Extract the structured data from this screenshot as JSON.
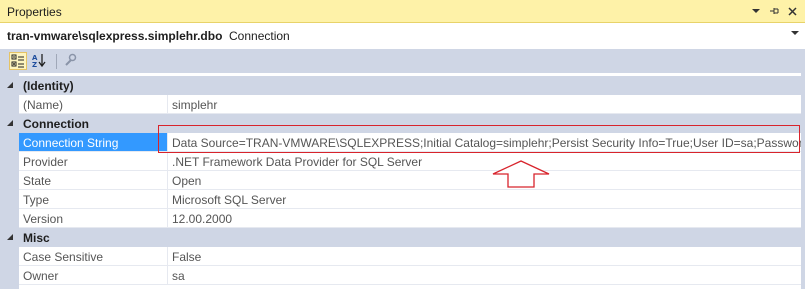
{
  "window": {
    "title": "Properties"
  },
  "object_selector": {
    "name": "tran-vmware\\sqlexpress.simplehr.dbo",
    "type": "Connection"
  },
  "toolbar": {
    "buttons": [
      "categorized-icon",
      "alphabetical-icon",
      "property-pages-icon"
    ]
  },
  "categories": [
    {
      "label": "(Identity)",
      "properties": [
        {
          "name": "(Name)",
          "value": "simplehr"
        }
      ]
    },
    {
      "label": "Connection",
      "properties": [
        {
          "name": "Connection String",
          "value": "Data Source=TRAN-VMWARE\\SQLEXPRESS;Initial Catalog=simplehr;Persist Security Info=True;User ID=sa;Password=**"
        },
        {
          "name": "Provider",
          "value": ".NET Framework Data Provider for SQL Server"
        },
        {
          "name": "State",
          "value": "Open"
        },
        {
          "name": "Type",
          "value": "Microsoft SQL Server"
        },
        {
          "name": "Version",
          "value": "12.00.2000"
        }
      ]
    },
    {
      "label": "Misc",
      "properties": [
        {
          "name": "Case Sensitive",
          "value": "False"
        },
        {
          "name": "Owner",
          "value": "sa"
        }
      ]
    }
  ],
  "colors": {
    "title_bg": "#fef2a8",
    "gutter": "#cfd6e5",
    "selection": "#3399ff",
    "annotation": "#d8242c"
  }
}
